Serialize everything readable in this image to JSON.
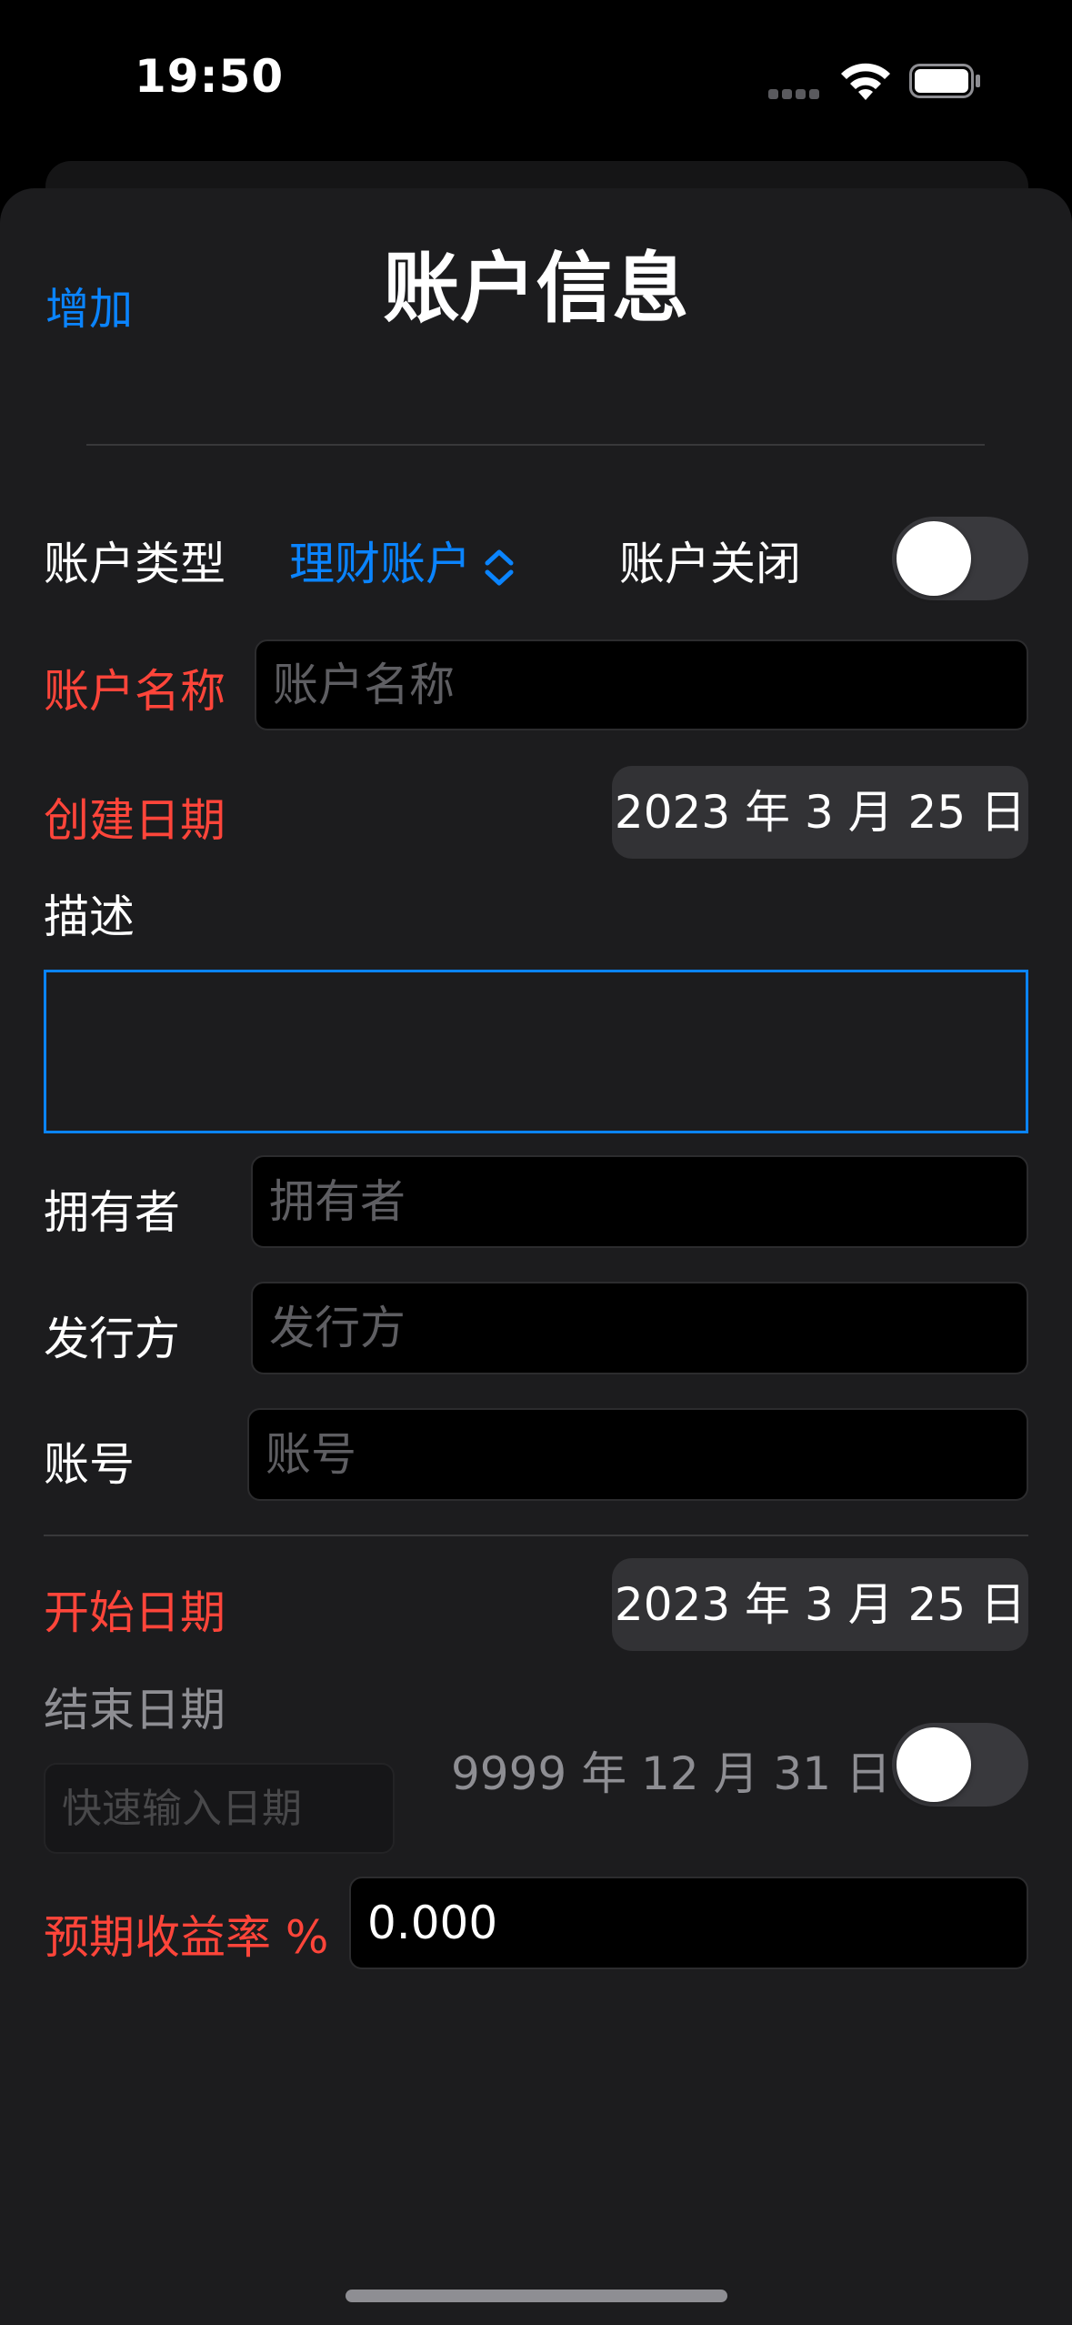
{
  "status_bar": {
    "time": "19:50"
  },
  "nav": {
    "add_label": "增加",
    "title": "账户信息"
  },
  "account_type": {
    "label": "账户类型",
    "value": "理财账户",
    "chevron_icon": "chevron-up-down-icon"
  },
  "account_closed": {
    "label": "账户关闭",
    "on": false
  },
  "account_name": {
    "label": "账户名称",
    "placeholder": "账户名称",
    "value": ""
  },
  "created_date": {
    "label": "创建日期",
    "value": "2023 年 3 月 25 日"
  },
  "description": {
    "label": "描述",
    "value": ""
  },
  "owner": {
    "label": "拥有者",
    "placeholder": "拥有者",
    "value": ""
  },
  "issuer": {
    "label": "发行方",
    "placeholder": "发行方",
    "value": ""
  },
  "account_number": {
    "label": "账号",
    "placeholder": "账号",
    "value": ""
  },
  "start_date": {
    "label": "开始日期",
    "value": "2023 年 3 月 25 日"
  },
  "end_date": {
    "label": "结束日期",
    "quick_placeholder": "快速输入日期",
    "value": "9999 年 12 月 31 日",
    "enabled": false
  },
  "expected_rate": {
    "label": "预期收益率 %",
    "value": "0.000"
  },
  "colors": {
    "accent": "#0a84ff",
    "required": "#ff453a",
    "background": "#1c1c1e"
  }
}
